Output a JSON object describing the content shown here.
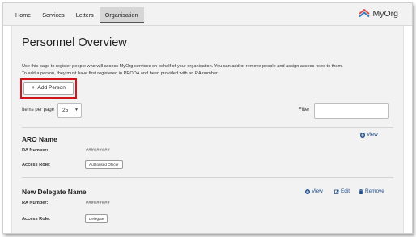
{
  "nav": {
    "items": [
      "Home",
      "Services",
      "Letters",
      "Organisation"
    ],
    "active_index": 3
  },
  "logo": {
    "label": "MyOrg",
    "icon": "myorg-chevron-logo"
  },
  "page": {
    "title": "Personnel Overview",
    "intro_line1": "Use this page to register people who will access MyOrg services on behalf of your organisation. You can add or remove people and assign access roles to them.",
    "intro_line2": "To add a person, they must have first registered in PRODA and been provided with an RA number."
  },
  "add_button": {
    "label": "Add Person",
    "icon": "plus-icon"
  },
  "list_controls": {
    "items_per_page_label": "Items per page",
    "items_per_page_value": "25",
    "filter_label": "Filter",
    "filter_value": ""
  },
  "people": [
    {
      "name": "ARO Name",
      "ra_label": "RA Number:",
      "ra_value": "#########",
      "role_label": "Access Role:",
      "role_value": "Authorised Officer",
      "actions": [
        "View"
      ]
    },
    {
      "name": "New Delegate Name",
      "ra_label": "RA Number:",
      "ra_value": "#########",
      "role_label": "Access Role:",
      "role_value": "Delegate",
      "actions": [
        "View",
        "Edit",
        "Remove"
      ]
    }
  ],
  "colors": {
    "link": "#1f4e8c",
    "highlight": "#d1151b",
    "logo_red": "#d9534f",
    "logo_blue": "#3b7bbf",
    "panel_bg": "#f2f2f2"
  }
}
